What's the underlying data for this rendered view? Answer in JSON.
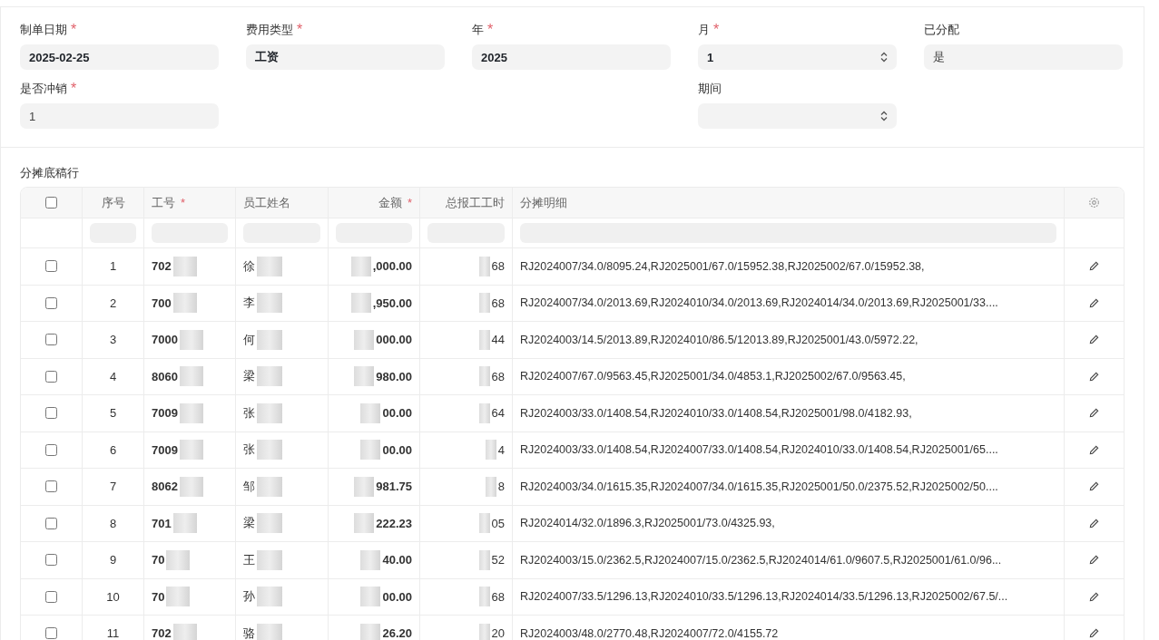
{
  "form": {
    "fields": [
      {
        "label": "制单日期",
        "required_mark": "*",
        "value": "2025-02-25",
        "kind": "text"
      },
      {
        "label": "费用类型",
        "required_mark": "*",
        "value": "工资",
        "kind": "text"
      },
      {
        "label": "年",
        "required_mark": "*",
        "value": "2025",
        "kind": "text"
      },
      {
        "label": "月",
        "required_mark": "*",
        "value": "1",
        "kind": "select"
      },
      {
        "label": "已分配",
        "value": "是",
        "kind": "readonly"
      },
      {
        "label": "是否冲销",
        "required_mark": "*",
        "value": "1",
        "kind": "readonly"
      },
      {
        "kind": "spacer"
      },
      {
        "kind": "spacer"
      },
      {
        "label": "期间",
        "kind": "select"
      }
    ]
  },
  "table": {
    "title": "分摊底稿行",
    "all_checked": false,
    "columns": [
      {
        "label": "序号"
      },
      {
        "label": "工号",
        "required_mark": "*"
      },
      {
        "label": "员工姓名"
      },
      {
        "label": "金额",
        "required_mark": "*"
      },
      {
        "label": "总报工工时"
      },
      {
        "label": "分摊明细"
      }
    ],
    "rows": [
      {
        "checked": false,
        "index": "1",
        "emp_no": "702",
        "name": "徐",
        "amount": ",000.00",
        "hours": "68",
        "detail": "RJ2024007/34.0/8095.24,RJ2025001/67.0/15952.38,RJ2025002/67.0/15952.38,"
      },
      {
        "checked": false,
        "index": "2",
        "emp_no": "700",
        "name": "李",
        "amount": ",950.00",
        "hours": "68",
        "detail": "RJ2024007/34.0/2013.69,RJ2024010/34.0/2013.69,RJ2024014/34.0/2013.69,RJ2025001/33...."
      },
      {
        "checked": false,
        "index": "3",
        "emp_no": "7000",
        "name": "何",
        "amount": "000.00",
        "hours": "44",
        "detail": "RJ2024003/14.5/2013.89,RJ2024010/86.5/12013.89,RJ2025001/43.0/5972.22,"
      },
      {
        "checked": false,
        "index": "4",
        "emp_no": "8060",
        "name": "梁",
        "amount": "980.00",
        "hours": "68",
        "detail": "RJ2024007/67.0/9563.45,RJ2025001/34.0/4853.1,RJ2025002/67.0/9563.45,"
      },
      {
        "checked": false,
        "index": "5",
        "emp_no": "7009",
        "name": "张",
        "amount": "00.00",
        "hours": "64",
        "detail": "RJ2024003/33.0/1408.54,RJ2024010/33.0/1408.54,RJ2025001/98.0/4182.93,"
      },
      {
        "checked": false,
        "index": "6",
        "emp_no": "7009",
        "name": "张",
        "amount": "00.00",
        "hours": "4",
        "detail": "RJ2024003/33.0/1408.54,RJ2024007/33.0/1408.54,RJ2024010/33.0/1408.54,RJ2025001/65...."
      },
      {
        "checked": false,
        "index": "7",
        "emp_no": "8062",
        "name": "邹",
        "amount": "981.75",
        "hours": "8",
        "detail": "RJ2024003/34.0/1615.35,RJ2024007/34.0/1615.35,RJ2025001/50.0/2375.52,RJ2025002/50...."
      },
      {
        "checked": false,
        "index": "8",
        "emp_no": "701",
        "name": "梁",
        "amount": "222.23",
        "hours": "05",
        "detail": "RJ2024014/32.0/1896.3,RJ2025001/73.0/4325.93,"
      },
      {
        "checked": false,
        "index": "9",
        "emp_no": "70",
        "name": "王",
        "amount": "40.00",
        "hours": "52",
        "detail": "RJ2024003/15.0/2362.5,RJ2024007/15.0/2362.5,RJ2024014/61.0/9607.5,RJ2025001/61.0/96..."
      },
      {
        "checked": false,
        "index": "10",
        "emp_no": "70",
        "name": "孙",
        "amount": "00.00",
        "hours": "68",
        "detail": "RJ2024007/33.5/1296.13,RJ2024010/33.5/1296.13,RJ2024014/33.5/1296.13,RJ2025002/67.5/..."
      },
      {
        "checked": false,
        "index": "11",
        "emp_no": "702",
        "name": "骆",
        "amount": "26.20",
        "hours": "20",
        "detail": "RJ2024003/48.0/2770.48,RJ2024007/72.0/4155.72"
      }
    ]
  }
}
